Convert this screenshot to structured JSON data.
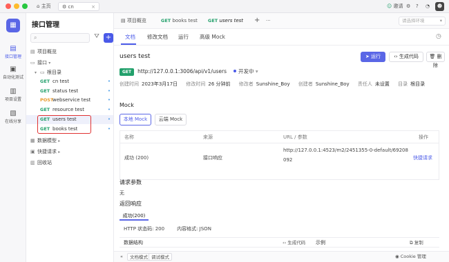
{
  "titlebar": {
    "home_label": "主页",
    "tab_label": "cn",
    "tab_close": "×",
    "invite_label": "邀请"
  },
  "rail": {
    "items": [
      {
        "label": "接口管理"
      },
      {
        "label": "自动化测试"
      },
      {
        "label": "项目设置"
      },
      {
        "label": "在线分享"
      }
    ]
  },
  "sidebar": {
    "title": "接口管理",
    "overview": "项目概览",
    "interfaces": "接口",
    "root": "根目录",
    "apis": [
      {
        "method": "GET",
        "name": "cn test"
      },
      {
        "method": "GET",
        "name": "status test"
      },
      {
        "method": "POST",
        "name": "webservice test"
      },
      {
        "method": "GET",
        "name": "resource test"
      },
      {
        "method": "GET",
        "name": "users test"
      },
      {
        "method": "GET",
        "name": "books test"
      }
    ],
    "data_models": "数据模型",
    "quick_requests": "快捷请求",
    "recycle_bin": "回收站"
  },
  "tabs": {
    "overview": "项目概览",
    "books_method": "GET",
    "books_name": "books test",
    "users_method": "GET",
    "users_name": "users test",
    "add": "+",
    "more": "···",
    "env_placeholder": "请选择环境"
  },
  "subtabs": [
    "文档",
    "修改文档",
    "运行",
    "高级 Mock"
  ],
  "api": {
    "name": "users test",
    "run_label": "运行",
    "gen_code_label": "生成代码",
    "delete_label": "删除",
    "method": "GET",
    "url": "http://127.0.0.1:3006/api/v1/users",
    "status": "开发中",
    "meta": [
      {
        "k": "创建时间",
        "v": "2023年3月17日"
      },
      {
        "k": "修改时间",
        "v": "26 分钟前"
      },
      {
        "k": "修改者",
        "v": "Sunshine_Boy"
      },
      {
        "k": "创建者",
        "v": "Sunshine_Boy"
      },
      {
        "k": "责任人",
        "v": "未设置"
      },
      {
        "k": "目录",
        "v": "根目录"
      }
    ]
  },
  "mock": {
    "title": "Mock",
    "local_tab": "本地 Mock",
    "cloud_tab": "云端 Mock",
    "headers": [
      "名称",
      "来源",
      "URL / 参数",
      "操作"
    ],
    "row": {
      "name": "成功 (200)",
      "source": "接口响应",
      "url_line1": "http://127.0.0.1:4523/m2/2451355-0-default/69208",
      "url_line2": "092",
      "action": "快捷请求"
    }
  },
  "request_params": {
    "title": "请求参数",
    "value": "无"
  },
  "response": {
    "title": "返回响应",
    "tab": "成功(200)",
    "http_status": "HTTP 状态码: 200",
    "content_type": "内容格式: JSON",
    "structure_label": "数据结构",
    "gen_code_label": "生成代码",
    "example_label": "示例",
    "copy_label": "复制"
  },
  "bottombar": {
    "doc_mode": "文档模式",
    "debug_mode": "调试模式",
    "right": "Cookie 管理"
  }
}
